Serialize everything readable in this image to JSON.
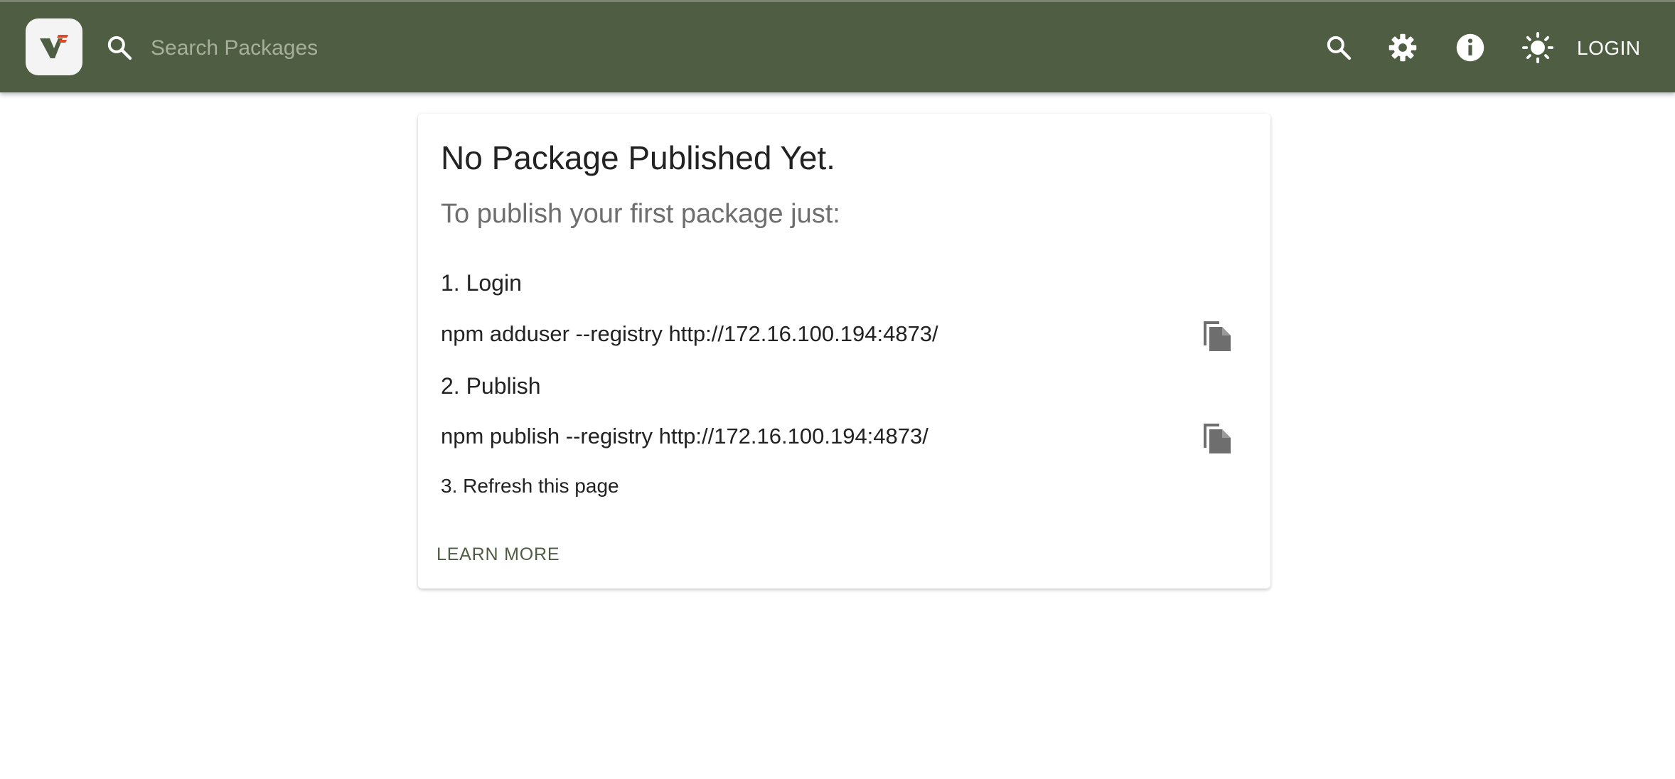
{
  "colors": {
    "header_bg": "#4f5e43",
    "accent": "#4f5e43",
    "logo_red": "#d84a2a"
  },
  "header": {
    "logo_icon": "verdaccio-logo-icon",
    "search": {
      "placeholder": "Search Packages",
      "value": "",
      "icon": "search-icon"
    },
    "actions": {
      "search_icon": "search-icon",
      "settings_icon": "gear-icon",
      "info_icon": "info-icon",
      "theme_icon": "sun-icon",
      "login_label": "LOGIN"
    }
  },
  "card": {
    "title": "No Package Published Yet.",
    "subtitle": "To publish your first package just:",
    "steps": [
      {
        "heading": "1. Login",
        "command": "npm adduser --registry http://172.16.100.194:4873/",
        "copy_icon": "copy-icon"
      },
      {
        "heading": "2. Publish",
        "command": "npm publish --registry http://172.16.100.194:4873/",
        "copy_icon": "copy-icon"
      }
    ],
    "refresh": "3. Refresh this page",
    "learn_more": "LEARN MORE"
  }
}
